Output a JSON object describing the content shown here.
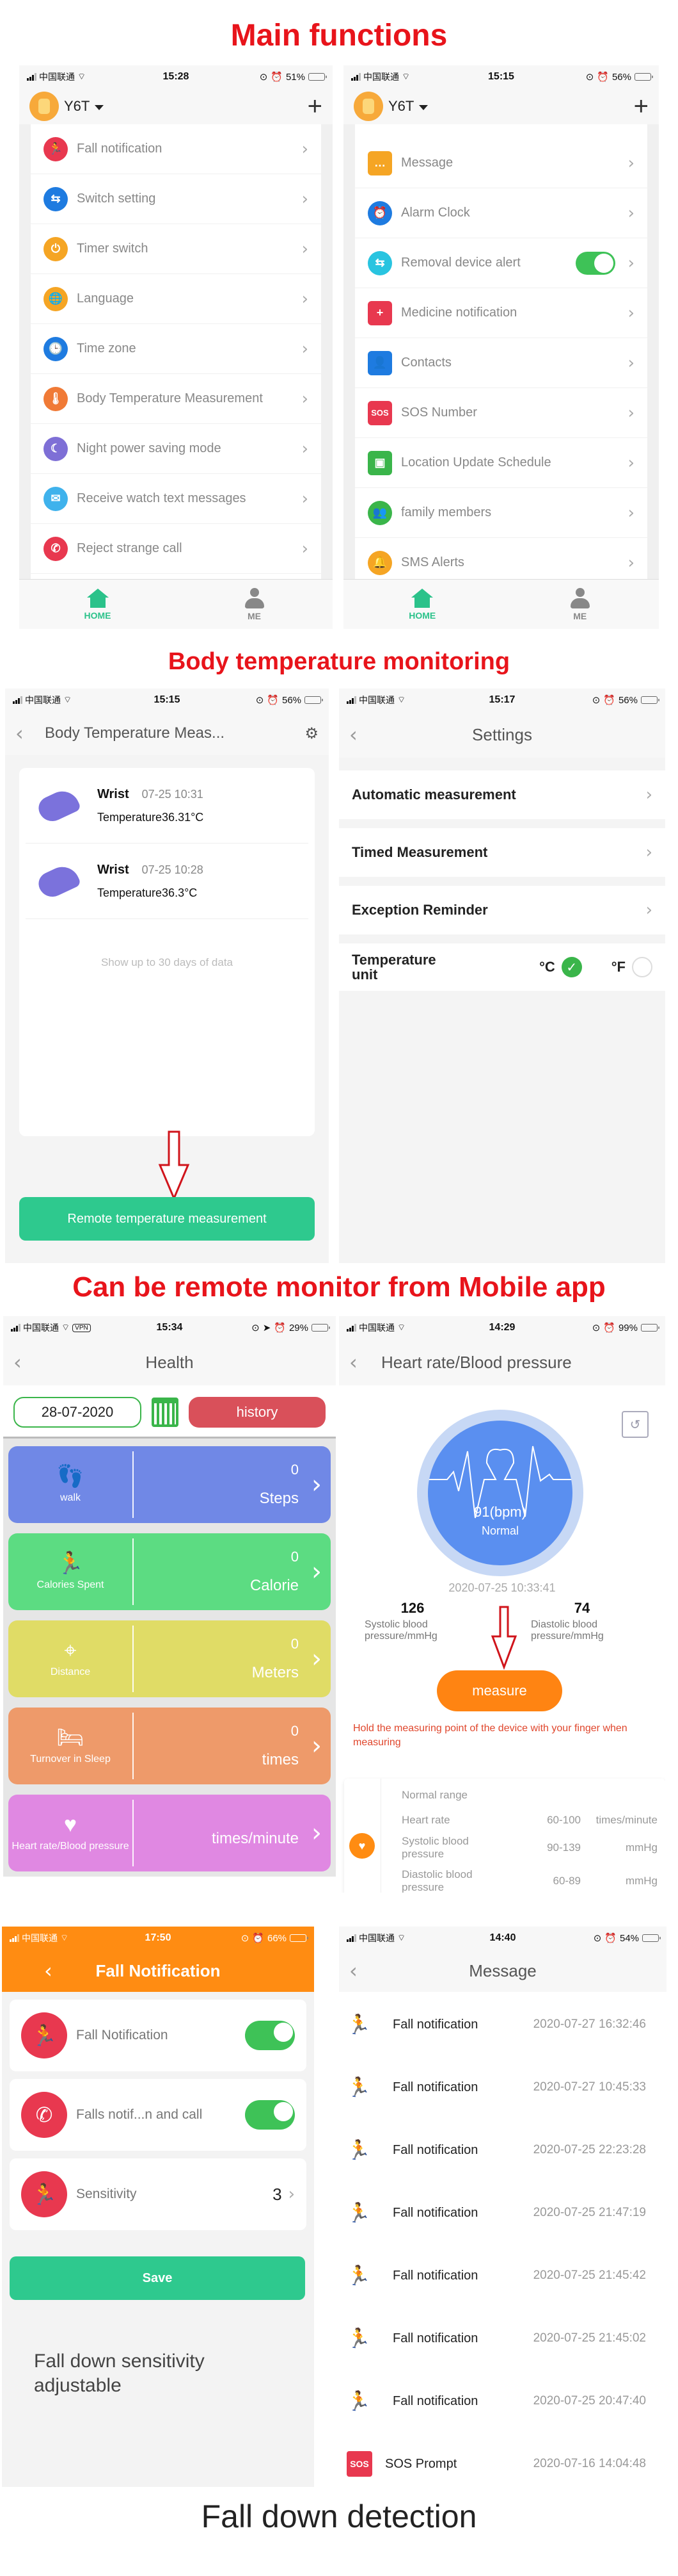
{
  "headings": {
    "main_functions": "Main functions",
    "body_temperature": "Body temperature monitoring",
    "remote_monitor": "Can be remote monitor from Mobile app",
    "fall_detection": "Fall down detection",
    "fall_sensitivity_note": "Fall down sensitivity adjustable"
  },
  "colors": {
    "heading_red": "#e8141b",
    "accent_green": "#2ec98e",
    "toggle_green": "#3ec257",
    "orange": "#ff8c12",
    "history_red": "#d9505a"
  },
  "carrier": "中国联通",
  "screen1": {
    "status": {
      "time": "15:28",
      "battery": "51%",
      "battery_level": 0.51
    },
    "device_name": "Y6T",
    "menu": [
      {
        "label": "Fall notification",
        "icon": "fall-icon",
        "color": "#e8384f"
      },
      {
        "label": "Switch setting",
        "icon": "switch-icon",
        "color": "#1e7be0"
      },
      {
        "label": "Timer switch",
        "icon": "timer-icon",
        "color": "#f5a524"
      },
      {
        "label": "Language",
        "icon": "globe-icon",
        "color": "#f5a524"
      },
      {
        "label": "Time zone",
        "icon": "clock-icon",
        "color": "#1e7be0"
      },
      {
        "label": "Body Temperature Measurement",
        "icon": "thermometer-icon",
        "color": "#f07a36"
      },
      {
        "label": "Night power saving mode",
        "icon": "moon-icon",
        "color": "#7e6fd6"
      },
      {
        "label": "Receive watch text messages",
        "icon": "envelope-icon",
        "color": "#3fb2ec"
      },
      {
        "label": "Reject strange call",
        "icon": "reject-call-icon",
        "color": "#e8384f"
      }
    ],
    "tabs": [
      {
        "label": "HOME",
        "active": true
      },
      {
        "label": "ME",
        "active": false
      }
    ]
  },
  "screen2": {
    "status": {
      "time": "15:15",
      "battery": "56%",
      "battery_level": 0.56
    },
    "device_name": "Y6T",
    "menu": [
      {
        "label": "Message",
        "icon": "message-icon",
        "color": "#f5a524"
      },
      {
        "label": "Alarm Clock",
        "icon": "alarm-clock-icon",
        "color": "#1e7be0"
      },
      {
        "label": "Removal device alert",
        "icon": "switch-icon",
        "color": "#29c4e0",
        "toggle": true
      },
      {
        "label": "Medicine notification",
        "icon": "medicine-icon",
        "color": "#e8384f"
      },
      {
        "label": "Contacts",
        "icon": "contacts-icon",
        "color": "#1e7be0"
      },
      {
        "label": "SOS Number",
        "icon": "sos-icon",
        "color": "#e8384f"
      },
      {
        "label": "Location Update Schedule",
        "icon": "location-schedule-icon",
        "color": "#3ab54a"
      },
      {
        "label": "family members",
        "icon": "family-icon",
        "color": "#3ab54a"
      },
      {
        "label": "SMS Alerts",
        "icon": "bell-icon",
        "color": "#f5a524"
      }
    ],
    "tabs": [
      {
        "label": "HOME",
        "active": true
      },
      {
        "label": "ME",
        "active": false
      }
    ]
  },
  "screen3": {
    "status": {
      "time": "15:15",
      "battery": "56%",
      "battery_level": 0.56
    },
    "title": "Body Temperature Meas...",
    "records": [
      {
        "location": "Wrist",
        "datetime": "07-25 10:31",
        "temperature": "Temperature36.31°C"
      },
      {
        "location": "Wrist",
        "datetime": "07-25 10:28",
        "temperature": "Temperature36.3°C"
      }
    ],
    "footer_note": "Show up to 30 days of data",
    "button": "Remote temperature measurement"
  },
  "screen4": {
    "status": {
      "time": "15:17",
      "battery": "56%",
      "battery_level": 0.56
    },
    "title": "Settings",
    "items": [
      {
        "label": "Automatic measurement"
      },
      {
        "label": "Timed Measurement"
      },
      {
        "label": "Exception Reminder"
      }
    ],
    "unit_label": "Temperature unit",
    "unit_options": [
      {
        "label": "°C",
        "selected": true
      },
      {
        "label": "°F",
        "selected": false
      }
    ]
  },
  "screen5": {
    "status": {
      "time": "15:34",
      "battery": "29%",
      "battery_level": 0.29,
      "vpn": "VPN"
    },
    "title": "Health",
    "date": "28-07-2020",
    "history_button": "history",
    "tiles": [
      {
        "label": "walk",
        "value": "0",
        "unit": "Steps",
        "color": "#7088e6",
        "icon": "footprints-icon"
      },
      {
        "label": "Calories Spent",
        "value": "0",
        "unit": "Calorie",
        "color": "#5cdc82",
        "icon": "running-icon"
      },
      {
        "label": "Distance",
        "value": "0",
        "unit": "Meters",
        "color": "#e0dc66",
        "icon": "route-icon"
      },
      {
        "label": "Turnover in Sleep",
        "value": "0",
        "unit": "times",
        "color": "#ee9a6a",
        "icon": "bed-icon"
      },
      {
        "label": "Heart rate/Blood pressure",
        "value": "",
        "unit": "times/minute",
        "color": "#e088e2",
        "icon": "heart-pulse-icon"
      }
    ]
  },
  "screen6": {
    "status": {
      "time": "14:29",
      "battery": "99%",
      "battery_level": 0.99,
      "charging": true
    },
    "title": "Heart rate/Blood pressure",
    "bpm": "91(bpm)",
    "bpm_status": "Normal",
    "timestamp": "2020-07-25 10:33:41",
    "systolic": {
      "value": "126",
      "label": "Systolic blood pressure/mmHg"
    },
    "diastolic": {
      "value": "74",
      "label": "Diastolic blood pressure/mmHg"
    },
    "measure_button": "measure",
    "hint": "Hold the measuring point of the device with your finger when measuring",
    "normal_range": {
      "title": "Normal range",
      "rows": [
        {
          "name": "Heart rate",
          "range": "60-100",
          "unit": "times/minute"
        },
        {
          "name": "Systolic blood pressure",
          "range": "90-139",
          "unit": "mmHg"
        },
        {
          "name": "Diastolic blood pressure",
          "range": "60-89",
          "unit": "mmHg"
        }
      ]
    }
  },
  "screen7": {
    "status": {
      "time": "17:50",
      "battery": "66%",
      "battery_level": 0.66
    },
    "title": "Fall Notification",
    "rows": [
      {
        "label": "Fall Notification",
        "toggle": true,
        "icon": "fall-icon"
      },
      {
        "label": "Falls notif...n and call",
        "toggle": true,
        "icon": "phone-icon"
      },
      {
        "label": "Sensitivity",
        "value": "3",
        "icon": "sensitivity-icon"
      }
    ],
    "save_button": "Save"
  },
  "screen8": {
    "status": {
      "time": "14:40",
      "battery": "54%",
      "battery_level": 0.54,
      "charging": true
    },
    "title": "Message",
    "messages": [
      {
        "type": "fall",
        "title": "Fall notification",
        "datetime": "2020-07-27 16:32:46"
      },
      {
        "type": "fall",
        "title": "Fall notification",
        "datetime": "2020-07-27 10:45:33"
      },
      {
        "type": "fall",
        "title": "Fall notification",
        "datetime": "2020-07-25 22:23:28"
      },
      {
        "type": "fall",
        "title": "Fall notification",
        "datetime": "2020-07-25 21:47:19"
      },
      {
        "type": "fall",
        "title": "Fall notification",
        "datetime": "2020-07-25 21:45:42"
      },
      {
        "type": "fall",
        "title": "Fall notification",
        "datetime": "2020-07-25 21:45:02"
      },
      {
        "type": "fall",
        "title": "Fall notification",
        "datetime": "2020-07-25 20:47:40"
      },
      {
        "type": "sos",
        "title": "SOS Prompt",
        "datetime": "2020-07-16 14:04:48",
        "badge": "SOS"
      }
    ]
  }
}
